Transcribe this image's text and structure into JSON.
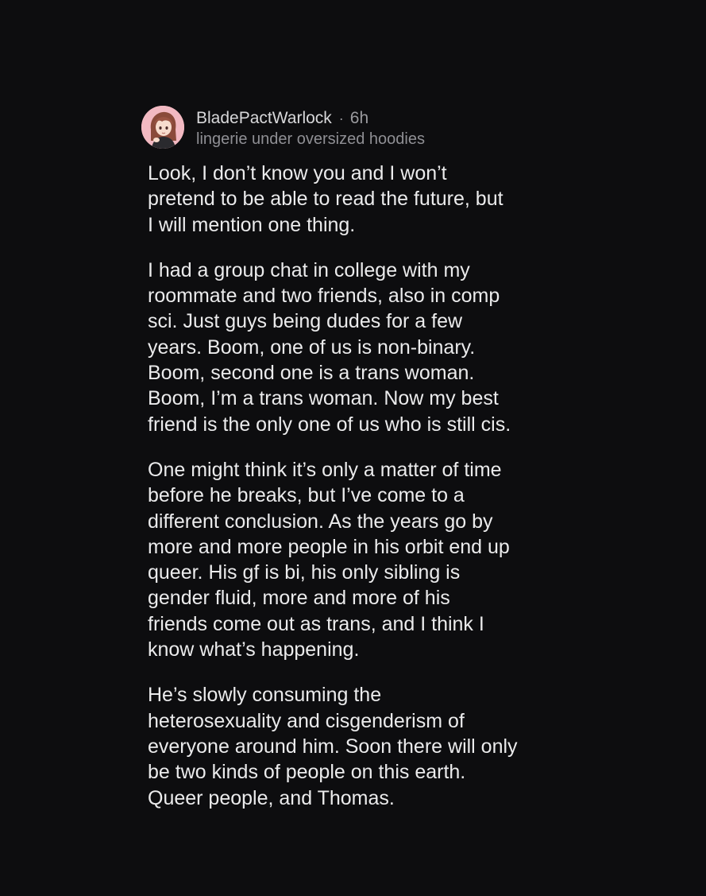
{
  "post": {
    "username": "BladePactWarlock",
    "separator": "·",
    "time": "6h",
    "flair": "lingerie under oversized hoodies",
    "paragraphs": [
      "Look, I don’t know you and I won’t\npretend to be able to read the future, but\nI will mention one thing.",
      "I had a group chat in college with my\nroommate and two friends, also in comp\nsci. Just guys being dudes for a few\nyears. Boom, one of us is non-binary.\nBoom, second one is a trans woman.\nBoom, I’m a trans woman. Now my best\nfriend is the only one of us who is still cis.",
      "One might think it’s only a matter of time\nbefore he breaks, but I’ve come to a\ndifferent conclusion. As the years go by\nmore and more people in his orbit end up\nqueer. His gf is bi, his only sibling is\ngender fluid, more and more of his\nfriends come out as trans, and I think I\nknow what’s happening.",
      "He’s slowly consuming the\nheterosexuality and cisgenderism of\neveryone around him. Soon there will only\nbe two kinds of people on this earth.\nQueer people, and Thomas."
    ]
  },
  "colors": {
    "background": "#0d0d0f",
    "text": "#ebebec",
    "muted": "#8f8f94",
    "avatar_bg": "#f2b9c2"
  }
}
